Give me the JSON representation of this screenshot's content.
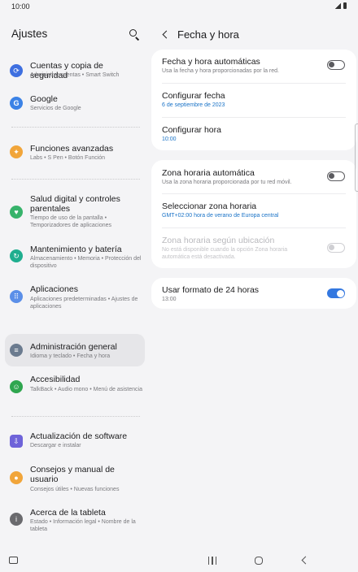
{
  "status_bar": {
    "time": "10:00"
  },
  "left_pane": {
    "title": "Ajustes",
    "items": [
      {
        "key": "accounts",
        "title": "Cuentas y copia de seguridad",
        "subtitle": "Administrar cuentas  •  Smart Switch",
        "icon": "sync-icon",
        "icon_color": "#3e6fe0"
      },
      {
        "key": "google",
        "title": "Google",
        "subtitle": "Servicios de Google",
        "icon": "google-icon",
        "icon_color": "#3b82e6"
      },
      {
        "key": "advanced",
        "title": "Funciones avanzadas",
        "subtitle": "Labs  •  S Pen  •  Botón Función",
        "icon": "gear-plus-icon",
        "icon_color": "#f1a53a"
      },
      {
        "key": "wellbeing",
        "title": "Salud digital y controles parentales",
        "subtitle": "Tiempo de uso de la pantalla  •  Temporizadores de aplicaciones",
        "icon": "heart-icon",
        "icon_color": "#37b36b"
      },
      {
        "key": "maintenance",
        "title": "Mantenimiento y batería",
        "subtitle": "Almacenamiento  •  Memoria  •  Protección del dispositivo",
        "icon": "refresh-icon",
        "icon_color": "#1fae8f"
      },
      {
        "key": "apps",
        "title": "Aplicaciones",
        "subtitle": "Aplicaciones predeterminadas  •  Ajustes de aplicaciones",
        "icon": "apps-grid-icon",
        "icon_color": "#5b8fe8"
      },
      {
        "key": "general",
        "title": "Administración general",
        "subtitle": "Idioma y teclado  •  Fecha y hora",
        "icon": "sliders-icon",
        "icon_color": "#6b7b8f"
      },
      {
        "key": "accessibility",
        "title": "Accesibilidad",
        "subtitle": "TalkBack  •  Audio mono  •  Menú de asistencia",
        "icon": "accessibility-icon",
        "icon_color": "#2fa64f"
      },
      {
        "key": "update",
        "title": "Actualización de software",
        "subtitle": "Descargar e instalar",
        "icon": "update-icon",
        "icon_color": "#6e63d9"
      },
      {
        "key": "tips",
        "title": "Consejos y manual de usuario",
        "subtitle": "Consejos útiles  •  Nuevas funciones",
        "icon": "lightbulb-icon",
        "icon_color": "#f1a53a"
      },
      {
        "key": "about",
        "title": "Acerca de la tableta",
        "subtitle": "Estado  •  Información legal  •  Nombre de la tableta",
        "icon": "info-icon",
        "icon_color": "#6a6a6e"
      }
    ]
  },
  "right_pane": {
    "title": "Fecha y hora",
    "auto_datetime": {
      "title": "Fecha y hora automáticas",
      "subtitle": "Usa la fecha y hora proporcionadas por la red.",
      "enabled": false
    },
    "set_date": {
      "title": "Configurar fecha",
      "value": "6 de septiembre de 2023"
    },
    "set_time": {
      "title": "Configurar hora",
      "value": "10:00"
    },
    "auto_timezone": {
      "title": "Zona horaria automática",
      "subtitle": "Usa la zona horaria proporcionada por tu red móvil.",
      "enabled": false
    },
    "select_timezone": {
      "title": "Seleccionar zona horaria",
      "value": "GMT+02:00 hora de verano de Europa central"
    },
    "location_timezone": {
      "title": "Zona horaria según ubicación",
      "subtitle": "No está disponible cuando la opción Zona horaria automática está desactivada.",
      "enabled": false,
      "disabled": true
    },
    "format_24h": {
      "title": "Usar formato de 24 horas",
      "subtitle": "13:00",
      "enabled": true
    }
  },
  "colors": {
    "accent": "#3478e0",
    "link_blue": "#1a73c7",
    "background": "#f4f4f6",
    "card": "#ffffff"
  }
}
